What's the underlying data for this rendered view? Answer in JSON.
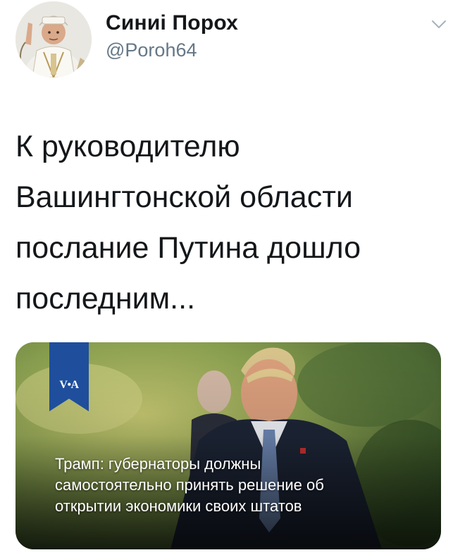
{
  "author": {
    "display_name": "Синиі Порох",
    "handle": "@Poroh64",
    "avatar_icon": "profile-avatar-icon"
  },
  "menu": {
    "icon": "chevron-down-icon"
  },
  "tweet": {
    "lines": [
      "К руководителю",
      "Вашингтонской области",
      "послание Путина дошло",
      "последним..."
    ]
  },
  "card": {
    "logo": "V•A",
    "headline_lines": [
      "Трамп: губернаторы должны",
      "самостоятельно принять решение об",
      "открытии экономики своих штатов"
    ],
    "colors": {
      "voa_blue": "#1f4e9c",
      "background": "#6f8a48"
    }
  }
}
